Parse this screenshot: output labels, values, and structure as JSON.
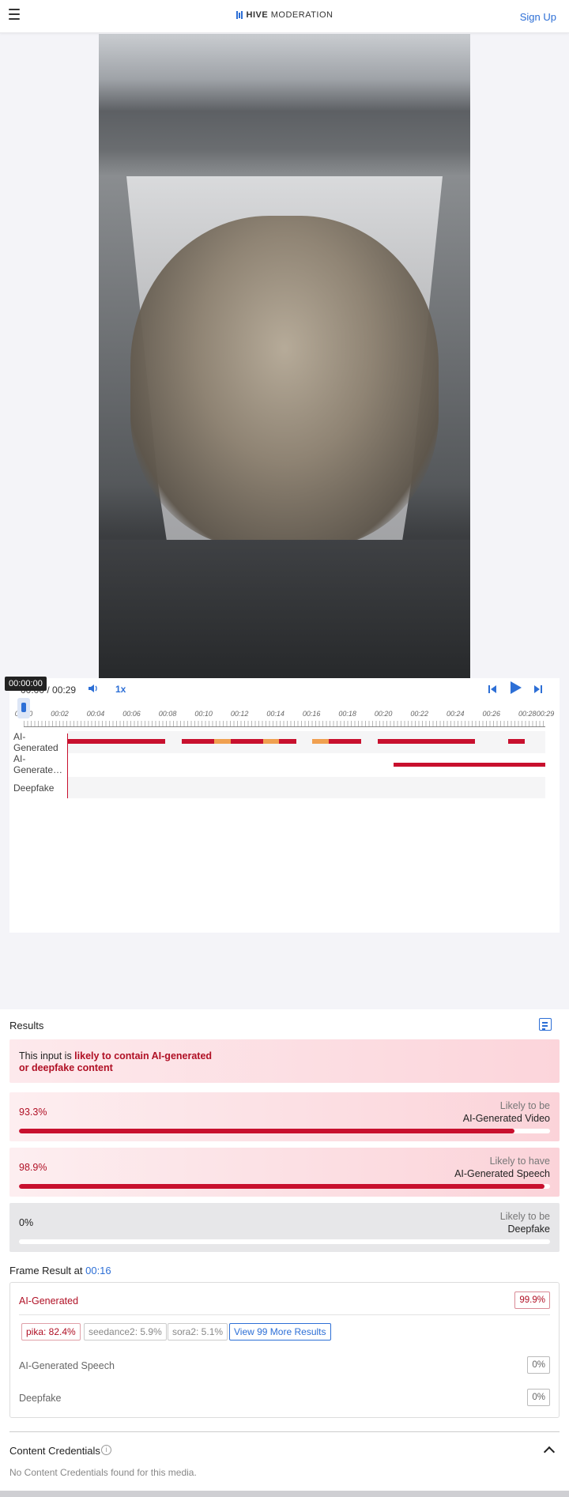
{
  "header": {
    "logo_bold": "HIVE",
    "logo_text": "MODERATION",
    "signup_label": "Sign Up"
  },
  "player": {
    "tooltip": "00:00:00",
    "time_current": "00:00",
    "time_total": "/ 00:29",
    "speed_label": "1x",
    "tick_labels": [
      "00:00",
      "00:02",
      "00:04",
      "00:06",
      "00:08",
      "00:10",
      "00:12",
      "00:14",
      "00:16",
      "00:18",
      "00:20",
      "00:22",
      "00:24",
      "00:26",
      "00:28",
      "00:29"
    ],
    "tracks": [
      {
        "label": "AI-\nGenerated"
      },
      {
        "label": "AI-\nGenerate…"
      },
      {
        "label": "Deepfake"
      }
    ]
  },
  "results": {
    "title": "Results",
    "alert_prefix": "This input is ",
    "alert_emphasis": "likely to contain AI-generated or deepfake content",
    "cards": [
      {
        "pct": "93.3%",
        "pretext": "Likely to be",
        "label": "AI-Generated Video",
        "fill": 0.933
      },
      {
        "pct": "98.9%",
        "pretext": "Likely to have",
        "label": "AI-Generated Speech",
        "fill": 0.989
      },
      {
        "pct": "0%",
        "pretext": "Likely to be",
        "label": "Deepfake",
        "fill": 0
      }
    ]
  },
  "frame": {
    "title_prefix": "Frame Result at",
    "time": "00:16",
    "ai_generated_label": "AI-Generated",
    "ai_generated_value": "99.9%",
    "chips": [
      "pika: 82.4%",
      "seedance2: 5.9%",
      "sora2: 5.1%"
    ],
    "more_label": "View 99 More Results",
    "speech_label": "AI-Generated Speech",
    "speech_value": "0%",
    "deepfake_label": "Deepfake",
    "deepfake_value": "0%"
  },
  "credentials": {
    "title": "Content Credentials",
    "info": "i",
    "none": "No Content Credentials found for this media."
  },
  "colors": {
    "accent": "#2d6fd6",
    "danger": "#c8102e",
    "warning": "#f0a050"
  }
}
